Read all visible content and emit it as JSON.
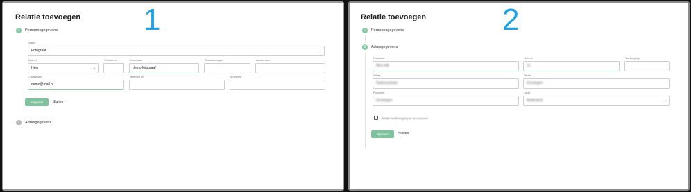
{
  "screen1": {
    "number": "1",
    "title": "Relatie toevoegen",
    "step1": {
      "num": "1",
      "label": "Persoonsgegevens"
    },
    "status": {
      "label": "Status",
      "value": "Fotograaf"
    },
    "aanhef": {
      "label": "Aanhef",
      "value": "Heer"
    },
    "voorletters": {
      "label": "Voorletters",
      "value": ""
    },
    "voornaam": {
      "label": "Voornaam",
      "value": "demo fotograaf"
    },
    "tussenvoegsel": {
      "label": "Tussenvoegsel",
      "value": ""
    },
    "achternaam": {
      "label": "Achternaam",
      "value": ""
    },
    "email": {
      "label": "E-mailadres",
      "value": "demo@mail.nl"
    },
    "telefoon": {
      "label": "Telefoon nr.",
      "value": ""
    },
    "mobiel": {
      "label": "Mobiel nr.",
      "value": ""
    },
    "next_label": "Volgende",
    "close_label": "Sluiten",
    "step2": {
      "num": "2",
      "label": "Adresgegevens"
    }
  },
  "screen2": {
    "number": "2",
    "title": "Relatie toevoegen",
    "step1": {
      "label": "Persoonsgegevens"
    },
    "step2": {
      "num": "2",
      "label": "Adresgegevens"
    },
    "postcode": {
      "label": "Postcode",
      "value": "9811 AB"
    },
    "huisnr": {
      "label": "Huis nr.",
      "value": "12"
    },
    "toevoeging": {
      "label": "Toevoeging",
      "value": ""
    },
    "adres": {
      "label": "Adres",
      "value": "Stationsstraat"
    },
    "plaats": {
      "label": "Plaats",
      "value": "Groningen"
    },
    "provincie": {
      "label": "Provincie",
      "value": "Groningen"
    },
    "land": {
      "label": "Land",
      "value": "Nederland"
    },
    "checkbox_label": "Relatie heeft toegang tot een account",
    "save_label": "Opslaan",
    "close_label": "Sluiten"
  },
  "colors": {
    "accent": "#7ec39d",
    "number": "#1ba2e8",
    "valid_underline": "#8bd0a3"
  }
}
